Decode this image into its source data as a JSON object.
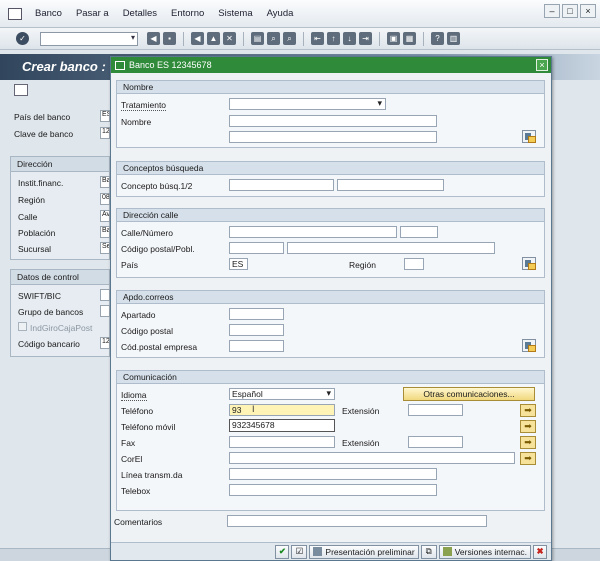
{
  "menu": {
    "items": [
      "Banco",
      "Pasar a",
      "Detalles",
      "Entorno",
      "Sistema",
      "Ayuda"
    ]
  },
  "background_screen": {
    "title": "Crear banco :",
    "fields": [
      {
        "label": "País del banco",
        "value": "ES"
      },
      {
        "label": "Clave de banco",
        "value": "12"
      }
    ],
    "direccion_title": "Dirección",
    "direccion": [
      {
        "label": "Instit.financ.",
        "value": "Ba"
      },
      {
        "label": "Región",
        "value": "08"
      },
      {
        "label": "Calle",
        "value": "Av"
      },
      {
        "label": "Población",
        "value": "Ba"
      },
      {
        "label": "Sucursal",
        "value": "Se"
      }
    ],
    "control_title": "Datos de control",
    "control": [
      {
        "label": "SWIFT/BIC",
        "value": ""
      },
      {
        "label": "Grupo de bancos",
        "value": ""
      },
      {
        "label": "IndGiroCajaPost",
        "value": ""
      },
      {
        "label": "Código bancario",
        "value": "12"
      }
    ]
  },
  "dialog": {
    "title": "Banco ES 12345678",
    "nombre": {
      "title": "Nombre",
      "tratamiento_label": "Tratamiento",
      "nombre_label": "Nombre"
    },
    "conceptos": {
      "title": "Conceptos búsqueda",
      "label": "Concepto búsq.1/2"
    },
    "direccion": {
      "title": "Dirección calle",
      "calle_label": "Calle/Número",
      "cp_label": "Código postal/Pobl.",
      "pais_label": "País",
      "pais_value": "ES",
      "region_label": "Región"
    },
    "apdo": {
      "title": "Apdo.correos",
      "apartado_label": "Apartado",
      "cp_label": "Código postal",
      "cp_empresa_label": "Cód.postal empresa"
    },
    "comunicacion": {
      "title": "Comunicación",
      "idioma_label": "Idioma",
      "idioma_value": "Español",
      "otras_button": "Otras comunicaciones...",
      "telefono_label": "Teléfono",
      "telefono_value": "93",
      "extension_label": "Extensión",
      "movil_label": "Teléfono móvil",
      "movil_suggestion": "932345678",
      "fax_label": "Fax",
      "extension2_label": "Extensión",
      "correl_label": "CorEl",
      "linea_label": "Línea transm.da",
      "telebox_label": "Telebox"
    },
    "comentarios_label": "Comentarios",
    "footer": {
      "presentacion_label": "Presentación preliminar",
      "versiones_label": "Versiones internac."
    }
  }
}
